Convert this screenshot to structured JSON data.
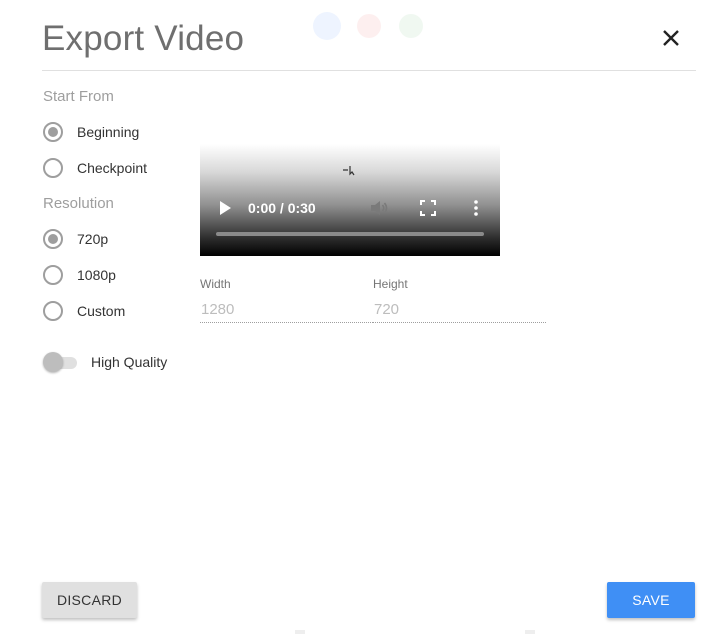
{
  "dialog": {
    "title": "Export Video",
    "close_icon": "close-icon"
  },
  "start_from": {
    "label": "Start From",
    "options": [
      {
        "label": "Beginning",
        "checked": true
      },
      {
        "label": "Checkpoint",
        "checked": false
      }
    ]
  },
  "resolution": {
    "label": "Resolution",
    "options": [
      {
        "label": "720p",
        "checked": true
      },
      {
        "label": "1080p",
        "checked": false
      },
      {
        "label": "Custom",
        "checked": false
      }
    ]
  },
  "high_quality": {
    "label": "High Quality",
    "enabled": false
  },
  "video": {
    "time": "0:00 / 0:30",
    "icons": [
      "play-icon",
      "volume-icon",
      "fullscreen-icon",
      "more-options-icon"
    ]
  },
  "dimensions": {
    "width_label": "Width",
    "width_placeholder": "1280",
    "height_label": "Height",
    "height_placeholder": "720"
  },
  "actions": {
    "discard_label": "DISCARD",
    "save_label": "SAVE"
  },
  "colors": {
    "accent": "#3f8ff5",
    "radio": "#9e9e9e"
  }
}
